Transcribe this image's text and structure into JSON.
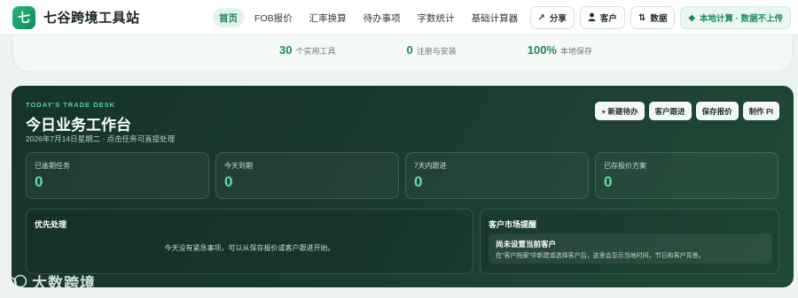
{
  "brand": {
    "logo_char": "七",
    "name": "七谷跨境工具站"
  },
  "nav": [
    {
      "label": "首页",
      "active": true
    },
    {
      "label": "FOB报价",
      "active": false
    },
    {
      "label": "汇率换算",
      "active": false
    },
    {
      "label": "待办事项",
      "active": false
    },
    {
      "label": "字数统计",
      "active": false
    },
    {
      "label": "基础计算器",
      "active": false
    }
  ],
  "actions": {
    "share": {
      "icon": "arrow-up-right-icon",
      "label": "分享"
    },
    "customer": {
      "icon": "user-icon",
      "label": "客户"
    },
    "data": {
      "icon": "sort-arrows-icon",
      "label": "数据"
    },
    "local": {
      "icon": "diamond-icon",
      "label": "本地计算 · 数据不上传"
    }
  },
  "hero": {
    "stats": [
      {
        "num": "30",
        "label": "个实用工具"
      },
      {
        "num": "0",
        "label": "注册与安装"
      },
      {
        "num": "100%",
        "label": "本地保存"
      }
    ]
  },
  "desk": {
    "eyebrow": "TODAY'S TRADE DESK",
    "title": "今日业务工作台",
    "subtitle": "2026年7月14日星期二 · 点击任务可直接处理",
    "buttons": {
      "new_todo": "+ 新建待办",
      "follow_up": "客户跟进",
      "save_quote": "保存报价",
      "make_pi": "制作 PI"
    },
    "stats": [
      {
        "label": "已逾期任务",
        "value": "0"
      },
      {
        "label": "今天到期",
        "value": "0"
      },
      {
        "label": "7天内跟进",
        "value": "0"
      },
      {
        "label": "已存报价方案",
        "value": "0"
      }
    ],
    "priority": {
      "title": "优先处理",
      "empty": "今天没有紧急事项，可以从保存报价或客户跟进开始。"
    },
    "market": {
      "title": "客户市场提醒",
      "card_title": "尚未设置当前客户",
      "card_desc": "在“客户档案”中新建或选择客户后，这里会显示当地时间、节日和客户背景。"
    }
  },
  "watermark": {
    "text": "大数跨境"
  },
  "colors": {
    "accent": "#1c8a5a",
    "accent_bright": "#5fe0a6",
    "desk_bg": "#1b3a2f"
  }
}
